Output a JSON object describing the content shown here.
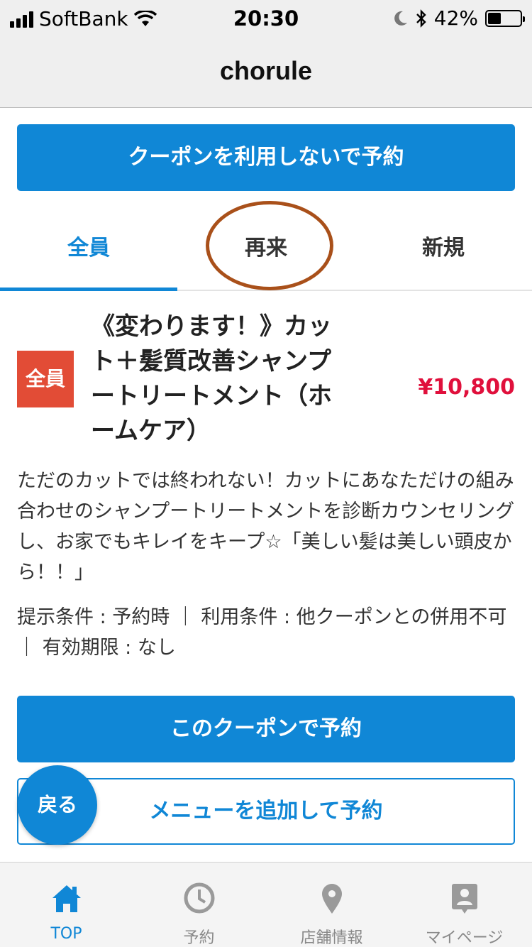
{
  "status_bar": {
    "carrier": "SoftBank",
    "time": "20:30",
    "battery_text": "42%",
    "battery_level": 0.42
  },
  "nav": {
    "title": "chorule"
  },
  "top_button": {
    "label": "クーポンを利用しないで予約"
  },
  "tabs": [
    {
      "label": "全員",
      "active": true
    },
    {
      "label": "再来",
      "active": false,
      "annotated": true
    },
    {
      "label": "新規",
      "active": false
    }
  ],
  "coupon": {
    "badge": "全員",
    "title": "《変わります！》カット＋髪質改善シャンプートリートメント（ホームケア）",
    "price": "¥10,800",
    "description": "ただのカットでは終われない！カットにあなただけの組み合わせのシャンプートリートメントを診断カウンセリングし、お家でもキレイをキープ☆「美しい髪は美しい頭皮から！！」",
    "conditions": "提示条件 : 予約時 ｜ 利用条件 : 他クーポンとの併用不可 ｜ 有効期限 : なし"
  },
  "reserve_button": {
    "label": "このクーポンで予約"
  },
  "add_menu_button": {
    "label": "メニューを追加して予約"
  },
  "back_button": {
    "label": "戻る"
  },
  "tab_bar": [
    {
      "label": "TOP",
      "icon": "home-icon",
      "active": true
    },
    {
      "label": "予約",
      "icon": "clock-icon",
      "active": false
    },
    {
      "label": "店舗情報",
      "icon": "map-pin-icon",
      "active": false
    },
    {
      "label": "マイページ",
      "icon": "user-card-icon",
      "active": false
    }
  ],
  "colors": {
    "accent": "#1087d6",
    "badge": "#e24c36",
    "price": "#e0103c",
    "annotation": "#a9501a"
  }
}
